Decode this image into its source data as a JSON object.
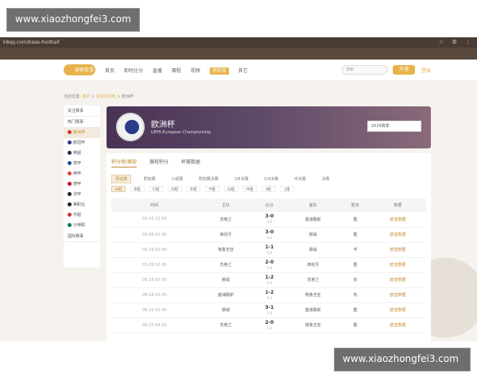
{
  "watermark": {
    "top": "www.xiaozhongfei3.com",
    "bottom": "www.xiaozhongfei3.com"
  },
  "browser": {
    "url": "k8qq.com/base-football"
  },
  "nav": {
    "logo_text": "球探百货",
    "items": [
      "首页",
      "即时比分",
      "直播",
      "赛程",
      "视频",
      "资料库",
      "其它"
    ],
    "search_placeholder": "搜索",
    "open_label": "开通",
    "login_label": "登录"
  },
  "breadcrumb": {
    "prefix": "当前位置:",
    "home": "首页",
    "section": "足球资料库",
    "current": "欧洲杯"
  },
  "sidebar": {
    "sections": [
      "关注赛事",
      "热门赛事"
    ],
    "items": [
      "欧洲杯",
      "欧冠杯",
      "英超",
      "意甲",
      "西甲",
      "德甲",
      "法甲",
      "美职业",
      "中超",
      "沙特联"
    ],
    "footer": "国际赛事"
  },
  "hero": {
    "title": "欧洲杯",
    "subtitle": "UEFA European Championship",
    "season": "2024赛季"
  },
  "tabs": [
    "积分榜/赛程",
    "赛程积分",
    "杯赛数据"
  ],
  "rounds": [
    "预选赛",
    "附加赛",
    "小组赛",
    "附加赛决赛",
    "1/8决赛",
    "1/4决赛",
    "半决赛",
    "决赛"
  ],
  "groups": [
    "A组",
    "B组",
    "C组",
    "D组",
    "E组",
    "F组",
    "G组",
    "H组",
    "I组",
    "J组"
  ],
  "table": {
    "headers": [
      "时间",
      "主队",
      "比分",
      "客队",
      "胜负",
      "数据"
    ],
    "rows": [
      {
        "time": "03-25 22:00",
        "home": "苏格兰",
        "score": "3-0",
        "ht": "1-0",
        "away": "塞浦路斯",
        "result": "胜",
        "data": "欧亚数据"
      },
      {
        "time": "03-26 02:45",
        "home": "西班牙",
        "score": "3-0",
        "ht": "1-0",
        "away": "挪威",
        "result": "胜",
        "data": "欧亚数据"
      },
      {
        "time": "03-29 02:45",
        "home": "格鲁吉亚",
        "score": "1-1",
        "ht": "0-0",
        "away": "挪威",
        "result": "平",
        "data": "欧亚数据"
      },
      {
        "time": "03-29 02:45",
        "home": "苏格兰",
        "score": "2-0",
        "ht": "1-0",
        "away": "西班牙",
        "result": "胜",
        "data": "欧亚数据"
      },
      {
        "time": "06-18 00:00",
        "home": "挪威",
        "score": "1-2",
        "ht": "0-0",
        "away": "苏格兰",
        "result": "负",
        "data": "欧亚数据"
      },
      {
        "time": "06-18 02:45",
        "home": "塞浦路斯",
        "score": "1-2",
        "ht": "0-2",
        "away": "格鲁吉亚",
        "result": "负",
        "data": "欧亚数据"
      },
      {
        "time": "06-21 02:45",
        "home": "挪威",
        "score": "3-1",
        "ht": "1-0",
        "away": "塞浦路斯",
        "result": "胜",
        "data": "欧亚数据"
      },
      {
        "time": "06-21 04:25",
        "home": "苏格兰",
        "score": "2-0",
        "ht": "1-0",
        "away": "格鲁吉亚",
        "result": "胜",
        "data": "欧亚数据"
      }
    ]
  }
}
